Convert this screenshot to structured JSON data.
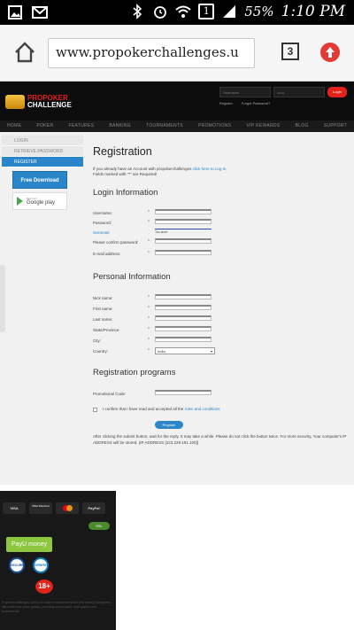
{
  "statusbar": {
    "battery_pct": "55%",
    "time": "1:10 PM",
    "sim_slot": "1"
  },
  "browser": {
    "url": "www.propokerchallenges.u",
    "tab_count": "3"
  },
  "site": {
    "logo_line1": "PROPOKER",
    "logo_line2": "CHALLENGE",
    "username_placeholder": "Username",
    "password_placeholder": "••••••",
    "login_label": "Login",
    "register_link": "Register",
    "forgot_link": "Forgot Password?",
    "nav": [
      "HOME",
      "POKER",
      "FEATURES",
      "BANKING",
      "TOURNAMENTS",
      "PROMOTIONS",
      "VIP REWARDS",
      "BLOG",
      "SUPPORT"
    ]
  },
  "sidebar": {
    "items": [
      "LOGIN",
      "RETRIEVE PASSWORD",
      "REGISTER"
    ],
    "free_download": "Free Download",
    "gplay_small": "Get it on",
    "gplay_big": "Google play"
  },
  "form": {
    "title": "Registration",
    "intro_text": "If you already have an Account with propokerchallenges",
    "intro_link": "click here to Log In.",
    "intro_required": "Fields marked with \"*\" are Required!",
    "login_info_title": "Login Information",
    "username_label": "Username:",
    "password_label": "Password:",
    "generate_label": "Generate",
    "strength_text": "Too short",
    "confirm_label": "Please confirm password:",
    "email_label": "E-mail address:",
    "personal_title": "Personal Information",
    "nick_label": "Nick name:",
    "first_label": "First name:",
    "last_label": "Last name:",
    "state_label": "State/Province:",
    "city_label": "City:",
    "country_label": "Country:",
    "country_value": "India",
    "programs_title": "Registration programs",
    "promo_label": "Promotional Code:",
    "confirm_text": "I confirm that I have read and accepted all the",
    "rules_link": "rules and conditions",
    "register_button": "Register",
    "note": "After clicking the submit button, wait for the reply. It may take a while. Please do not click the button twice. For more security, Your computer's IP ADDRESS will be stored. (IP ADDRESS [223.229.191.100])",
    "required_mark": "*"
  },
  "footer": {
    "pay1": "VISA",
    "pay2": "VISA Electron",
    "pay4": "PayPal",
    "ssl": "SSL",
    "payu": "PayU money",
    "badge1": "SECURE",
    "badge2": "VERIFIED",
    "age": "18+",
    "legal": "Propokerchallenges.com is an online entertainment and real money skill games site which has poker games, providing online poker, cash games and tournaments."
  },
  "colors": {
    "accent": "#2b86c9",
    "brand_red": "#e2231a",
    "required_green": "#3aa83a"
  }
}
